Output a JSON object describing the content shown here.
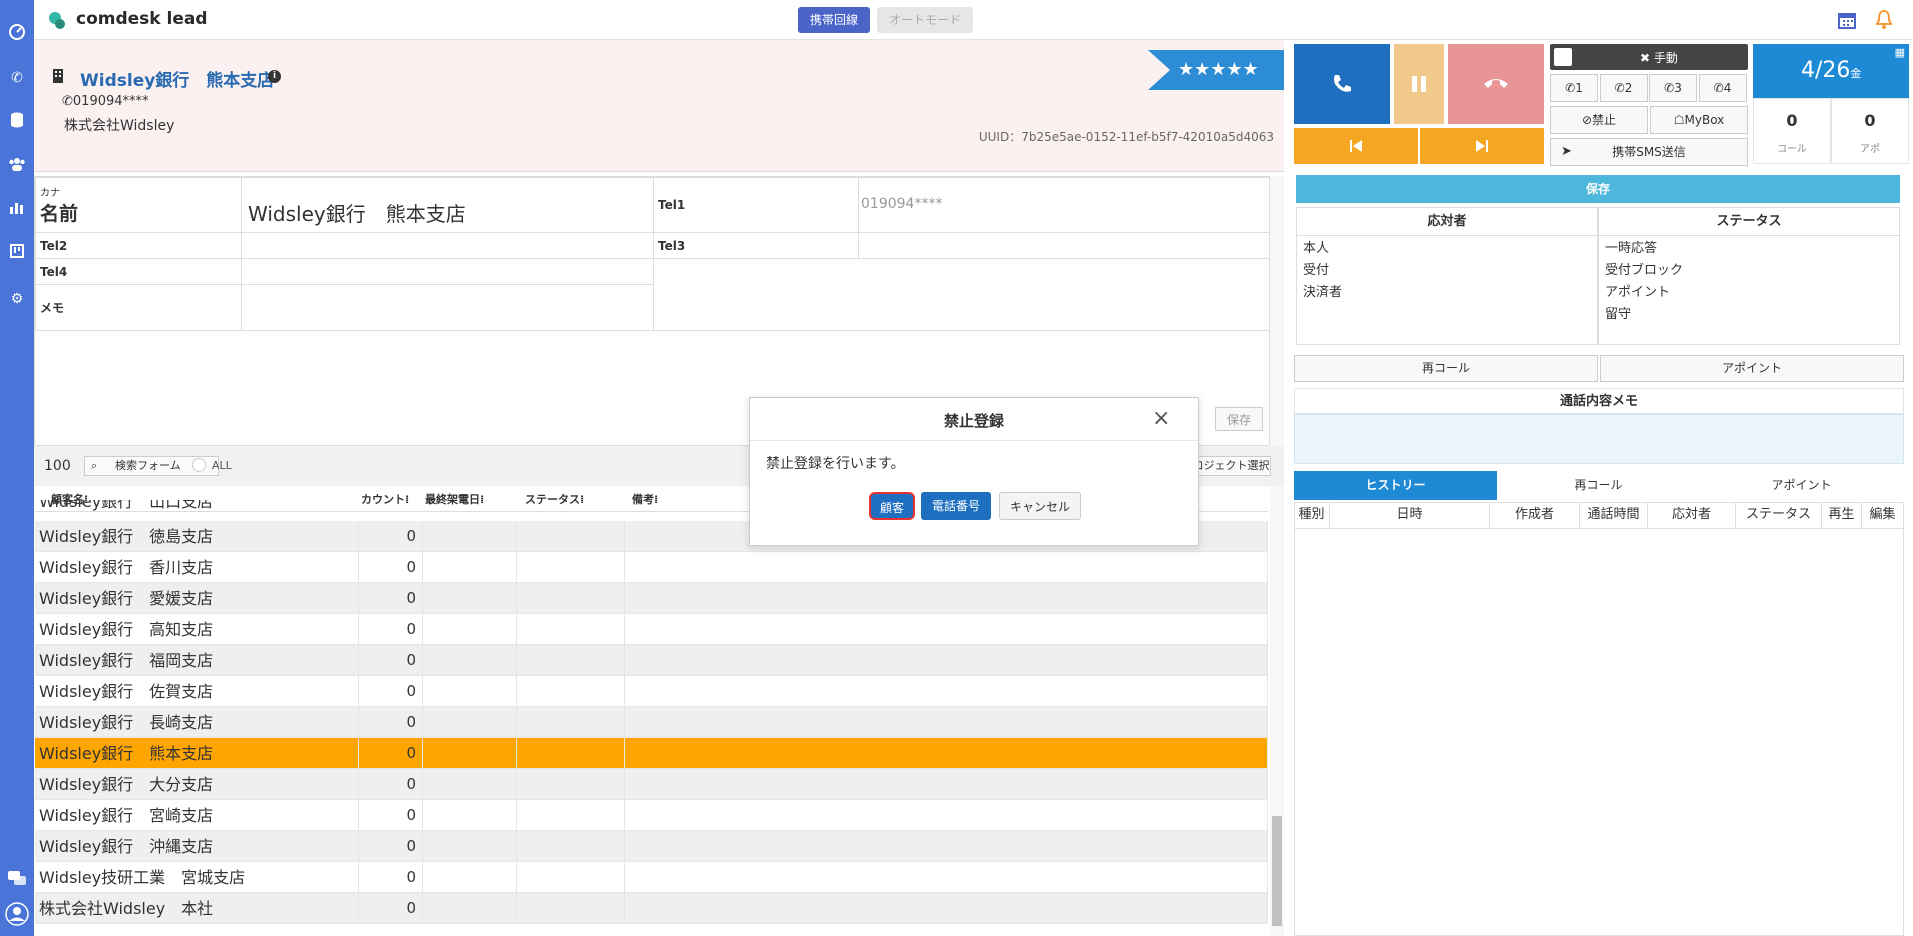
{
  "app": {
    "brand": "comdesk lead"
  },
  "topbar": {
    "mobile_line_label": "携帯回線",
    "auto_mode_label": "オートモード",
    "calendar_icon": "calendar-icon",
    "bell_icon": "bell-icon"
  },
  "sidebar": {
    "icons": [
      "dashboard-icon",
      "phone-icon",
      "database-icon",
      "users-icon",
      "chart-icon",
      "board-icon",
      "gear-icon"
    ],
    "bottom_icons": [
      "help-icon",
      "account-icon"
    ]
  },
  "customer": {
    "name": "Widsley銀行　熊本支店",
    "phone": "019094****",
    "company": "株式会社Widsley",
    "uuid": "UUID：7b25e5ae-0152-11ef-b5f7-42010a5d4063",
    "rating": "★★★★★"
  },
  "form": {
    "kana_label": "カナ",
    "name_label": "名前",
    "name_value": "Widsley銀行　熊本支店",
    "tel1_label": "Tel1",
    "tel1_value": "019094****",
    "tel2_label": "Tel2",
    "tel3_label": "Tel3",
    "tel4_label": "Tel4",
    "memo_label": "メモ",
    "save_label": "保存"
  },
  "list_toolbar": {
    "count": "100",
    "search_form_label": "検索フォーム",
    "all_label": "ALL",
    "project_select_label": "ロジェクト選択"
  },
  "grid": {
    "columns": [
      "顧客名⁞",
      "カウント⁞",
      "最終架電日⁞",
      "ステータス⁞",
      "備考⁞"
    ],
    "partial_row": "Widsley銀行　山口支店",
    "rows": [
      {
        "name": "Widsley銀行　徳島支店",
        "count": "0"
      },
      {
        "name": "Widsley銀行　香川支店",
        "count": "0"
      },
      {
        "name": "Widsley銀行　愛媛支店",
        "count": "0"
      },
      {
        "name": "Widsley銀行　高知支店",
        "count": "0"
      },
      {
        "name": "Widsley銀行　福岡支店",
        "count": "0"
      },
      {
        "name": "Widsley銀行　佐賀支店",
        "count": "0"
      },
      {
        "name": "Widsley銀行　長崎支店",
        "count": "0"
      },
      {
        "name": "Widsley銀行　熊本支店",
        "count": "0"
      },
      {
        "name": "Widsley銀行　大分支店",
        "count": "0"
      },
      {
        "name": "Widsley銀行　宮崎支店",
        "count": "0"
      },
      {
        "name": "Widsley銀行　沖縄支店",
        "count": "0"
      },
      {
        "name": "Widsley技研工業　宮城支店",
        "count": "0"
      },
      {
        "name": "株式会社Widsley　本社",
        "count": "0"
      }
    ],
    "highlight_color": "#ffa500"
  },
  "modal": {
    "title": "禁止登録",
    "message": "禁止登録を行います。",
    "customer_btn": "顧客",
    "phone_btn": "電話番号",
    "cancel_btn": "キャンセル"
  },
  "phone_panel": {
    "manual_label": "手動",
    "lines": [
      "1",
      "2",
      "3",
      "4"
    ],
    "ban_label": "禁止",
    "mybox_label": "MyBox",
    "sms_label": "携帯SMS送信",
    "date": "4/26",
    "weekday": "金",
    "call_count": "0",
    "call_label": "コール",
    "apo_count": "0",
    "apo_label": "アポ",
    "save_label": "保存"
  },
  "responder": {
    "header": "応対者",
    "options": [
      "本人",
      "受付",
      "決済者"
    ]
  },
  "status": {
    "header": "ステータス",
    "options": [
      "一時応答",
      "受付ブロック",
      "アポイント",
      "留守"
    ]
  },
  "actions": {
    "recall": "再コール",
    "appoint": "アポイント"
  },
  "memo": {
    "header": "通話内容メモ"
  },
  "history": {
    "tabs": [
      "ヒストリー",
      "再コール",
      "アポイント"
    ],
    "columns": [
      "種別",
      "日時",
      "作成者",
      "通話時間",
      "応対者",
      "ステータス",
      "再生",
      "編集"
    ]
  },
  "colors": {
    "accent": "#2c8cd6",
    "sidebar": "#4a74d8",
    "call_green": "#1e6fc0",
    "hold": "#f1c98a",
    "hangup": "#e89595",
    "orange": "#f5a623"
  }
}
